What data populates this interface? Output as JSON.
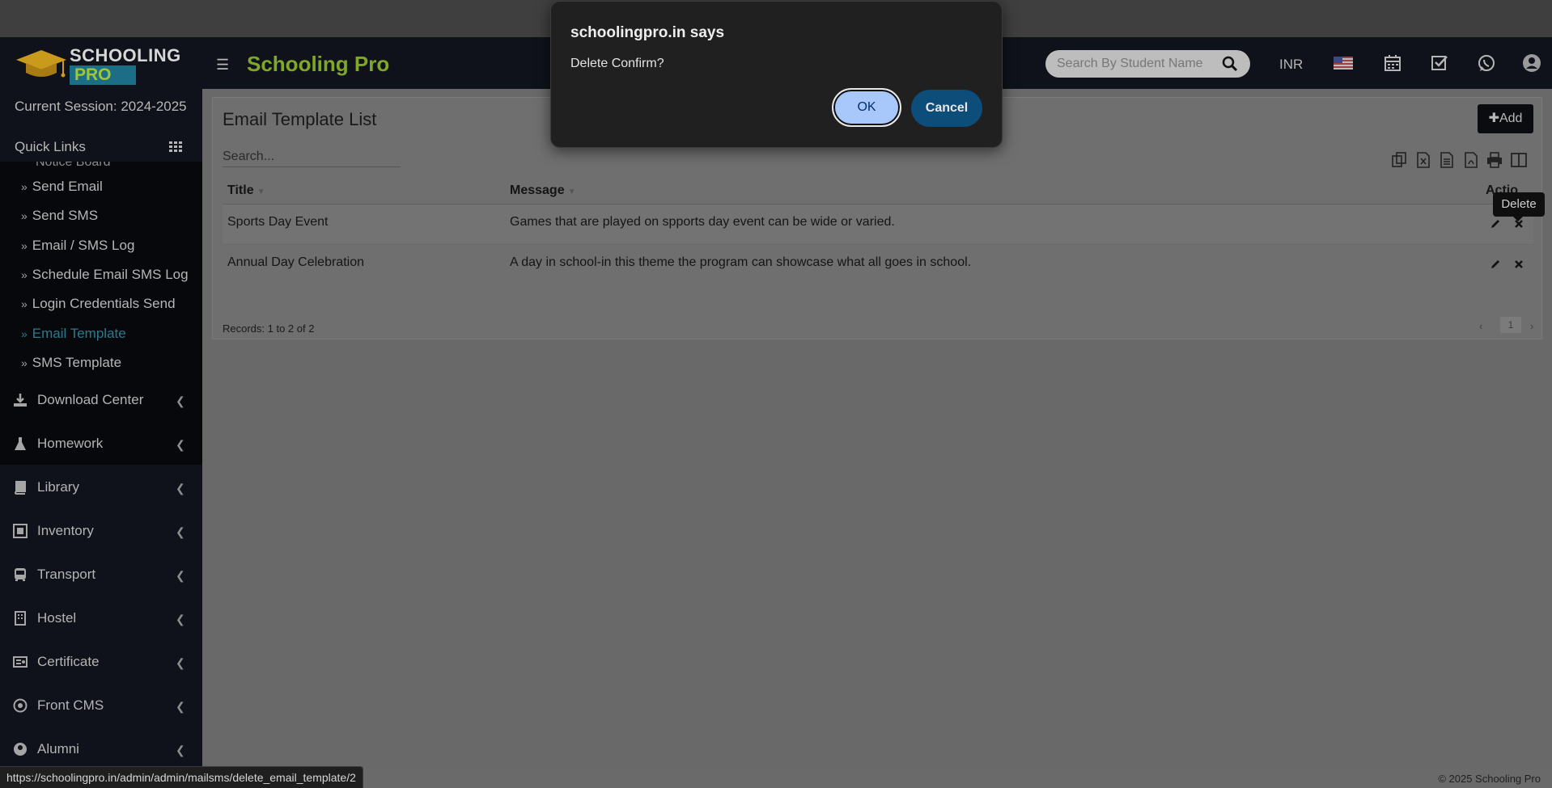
{
  "header": {
    "logo_line1": "SCHOOLING",
    "logo_line2": "PRO",
    "brand": "Schooling Pro",
    "search_placeholder": "Search By Student Name",
    "currency": "INR"
  },
  "sidebar": {
    "session": "Current Session: 2024-2025",
    "quick_links": "Quick Links",
    "cut_item": "Notice Board",
    "submenu": [
      "Send Email",
      "Send SMS",
      "Email / SMS Log",
      "Schedule Email SMS Log",
      "Login Credentials Send",
      "Email Template",
      "SMS Template"
    ],
    "active_submenu": "Email Template",
    "nav": [
      "Download Center",
      "Homework",
      "Library",
      "Inventory",
      "Transport",
      "Hostel",
      "Certificate",
      "Front CMS",
      "Alumni"
    ]
  },
  "main": {
    "title": "Email Template List",
    "add_label": "Add",
    "search_placeholder": "Search...",
    "columns": {
      "title": "Title",
      "message": "Message",
      "action": "Action"
    },
    "rows": [
      {
        "title": "Sports Day Event",
        "message": "Games that are played on spports day event can be wide or varied."
      },
      {
        "title": "Annual Day Celebration",
        "message": "A day in school-in this theme the program can showcase what all goes in school."
      }
    ],
    "records": "Records: 1 to 2 of 2",
    "page": "1",
    "tooltip": "Delete"
  },
  "footer": {
    "copyright": "© 2025 Schooling Pro",
    "status_url": "https://schoolingpro.in/admin/admin/mailsms/delete_email_template/2"
  },
  "dialog": {
    "title": "schoolingpro.in says",
    "message": "Delete Confirm?",
    "ok": "OK",
    "cancel": "Cancel"
  }
}
